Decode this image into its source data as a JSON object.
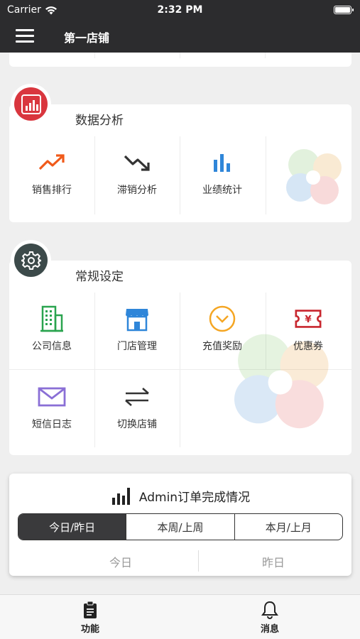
{
  "status_bar": {
    "carrier": "Carrier",
    "time": "2:32 PM"
  },
  "nav": {
    "title": "第一店铺"
  },
  "data_analysis": {
    "title": "数据分析",
    "items": [
      {
        "label": "销售排行",
        "icon": "trending-up-icon",
        "color": "#f05a1a"
      },
      {
        "label": "滞销分析",
        "icon": "trending-down-icon",
        "color": "#333333"
      },
      {
        "label": "业绩统计",
        "icon": "bar-chart-icon",
        "color": "#2f86d9"
      }
    ]
  },
  "general_settings": {
    "title": "常规设定",
    "items": [
      {
        "label": "公司信息",
        "icon": "building-icon",
        "color": "#2aa44f"
      },
      {
        "label": "门店管理",
        "icon": "store-icon",
        "color": "#2f86d9"
      },
      {
        "label": "充值奖励",
        "icon": "chevron-circle-icon",
        "color": "#f5a623"
      },
      {
        "label": "优惠券",
        "icon": "coupon-icon",
        "color": "#c8262e"
      },
      {
        "label": "短信日志",
        "icon": "envelope-icon",
        "color": "#8a6fd6"
      },
      {
        "label": "切换店铺",
        "icon": "swap-icon",
        "color": "#333333"
      }
    ]
  },
  "order_card": {
    "title": "Admin订单完成情况",
    "segments": [
      "今日/昨日",
      "本周/上周",
      "本月/上月"
    ],
    "active_segment": 0,
    "compare_tabs": [
      "今日",
      "昨日"
    ]
  },
  "tab_bar": {
    "items": [
      {
        "label": "功能",
        "icon": "clipboard-icon"
      },
      {
        "label": "消息",
        "icon": "bell-icon"
      }
    ]
  },
  "colors": {
    "header": "#2c2c2e",
    "analysis_badge": "#d9363e",
    "settings_badge": "#3c4a4a"
  }
}
